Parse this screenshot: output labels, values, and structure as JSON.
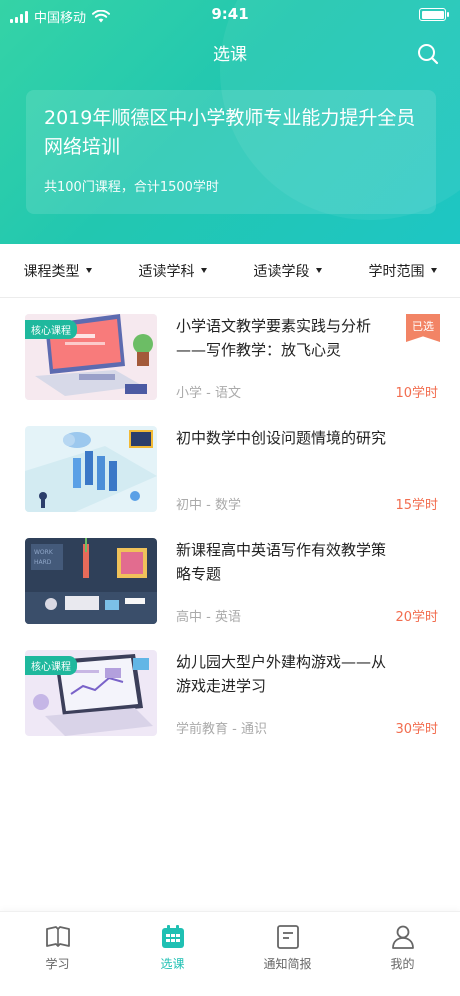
{
  "status": {
    "carrier": "中国移动",
    "time": "9:41"
  },
  "nav": {
    "title": "选课"
  },
  "banner": {
    "title": "2019年顺德区中小学教师专业能力提升全员网络培训",
    "subtitle": "共100门课程，合计1500学时"
  },
  "filters": [
    "课程类型",
    "适读学科",
    "适读学段",
    "学时范围"
  ],
  "courses": [
    {
      "title": "小学语文教学要素实践与分析——写作教学：放飞心灵",
      "meta": "小学 - 语文",
      "hours": "10学时",
      "tag": "核心课程",
      "selected": "已选"
    },
    {
      "title": "初中数学中创设问题情境的研究",
      "meta": "初中 - 数学",
      "hours": "15学时",
      "tag": "",
      "selected": ""
    },
    {
      "title": "新课程高中英语写作有效教学策略专题",
      "meta": "高中 - 英语",
      "hours": "20学时",
      "tag": "",
      "selected": ""
    },
    {
      "title": "幼儿园大型户外建构游戏——从游戏走进学习",
      "meta": "学前教育 - 通识",
      "hours": "30学时",
      "tag": "核心课程",
      "selected": ""
    }
  ],
  "tabs": [
    {
      "label": "学习",
      "icon": "book-icon"
    },
    {
      "label": "选课",
      "icon": "calendar-grid-icon",
      "active": true
    },
    {
      "label": "通知简报",
      "icon": "notice-icon"
    },
    {
      "label": "我的",
      "icon": "user-icon"
    }
  ],
  "colors": {
    "accent": "#1fc0b3",
    "hours": "#f26d4f",
    "selected_tag": "#f28465"
  }
}
